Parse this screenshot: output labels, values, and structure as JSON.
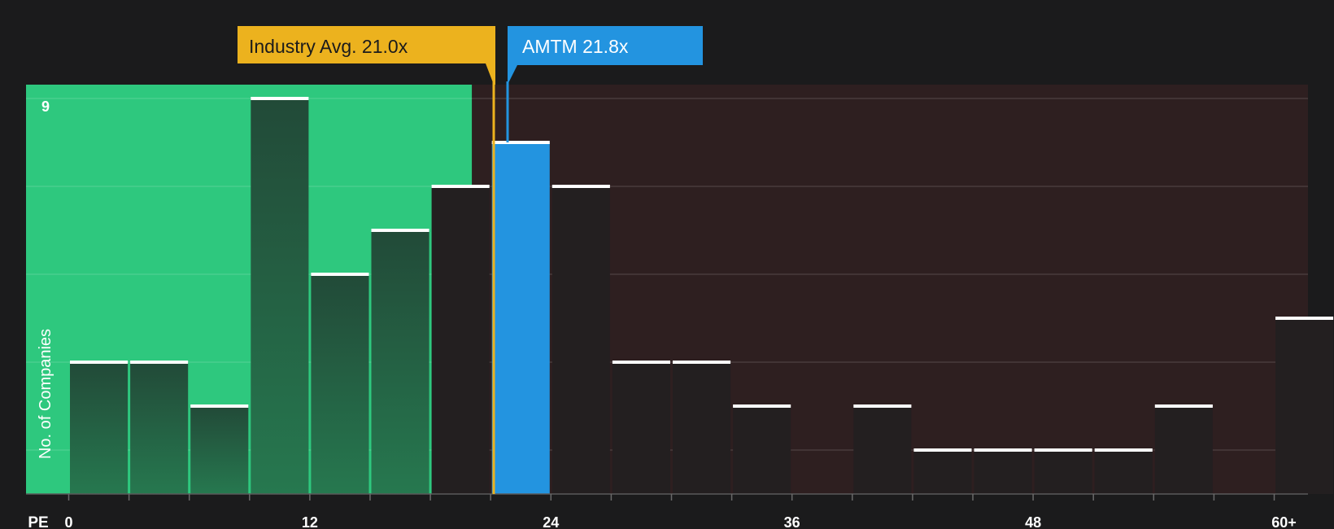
{
  "chart_data": {
    "type": "bar",
    "xlabel": "PE",
    "ylabel": "No. of Companies",
    "ylim": [
      0,
      9
    ],
    "y_ticks": [
      9
    ],
    "x_tick_labels": [
      "0",
      "12",
      "24",
      "36",
      "48",
      "60+"
    ],
    "x_tick_values": [
      0,
      12,
      24,
      36,
      48,
      60
    ],
    "bin_width": 3,
    "bins": [
      {
        "x0": 0,
        "count": 3
      },
      {
        "x0": 3,
        "count": 3
      },
      {
        "x0": 6,
        "count": 2
      },
      {
        "x0": 9,
        "count": 9
      },
      {
        "x0": 12,
        "count": 5
      },
      {
        "x0": 15,
        "count": 6
      },
      {
        "x0": 18,
        "count": 7
      },
      {
        "x0": 21,
        "count": 8,
        "highlight": true
      },
      {
        "x0": 24,
        "count": 7
      },
      {
        "x0": 27,
        "count": 3
      },
      {
        "x0": 30,
        "count": 3
      },
      {
        "x0": 33,
        "count": 2
      },
      {
        "x0": 36,
        "count": 0
      },
      {
        "x0": 39,
        "count": 2
      },
      {
        "x0": 42,
        "count": 1
      },
      {
        "x0": 45,
        "count": 1
      },
      {
        "x0": 48,
        "count": 1
      },
      {
        "x0": 51,
        "count": 1
      },
      {
        "x0": 54,
        "count": 2
      },
      {
        "x0": 57,
        "count": 0
      },
      {
        "x0": 60,
        "count": 4
      }
    ],
    "industry_avg": {
      "label": "Industry Avg. 21.0x",
      "value": 21.0
    },
    "company": {
      "label": "AMTM 21.8x",
      "value": 21.8
    },
    "colors": {
      "background": "#1b1b1c",
      "undervalued_zone": "#2ec87e",
      "overvalued_zone": "#2e1f20",
      "bar_in_green": "#224a38",
      "bar_in_red": "#231f20",
      "highlight_bar": "#2394e0",
      "industry_marker": "#ecb21e",
      "company_marker": "#2394e0",
      "bar_cap": "#ffffff",
      "axis_text": "#ffffff"
    }
  }
}
